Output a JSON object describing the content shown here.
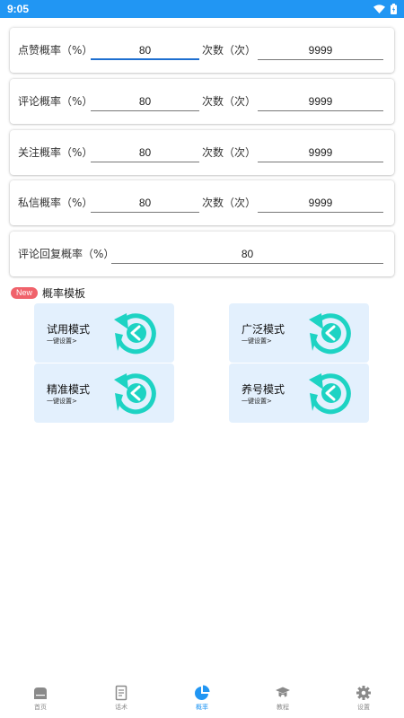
{
  "status_bar": {
    "time": "9:05"
  },
  "rate_rows": [
    {
      "label": "点赞概率（%）",
      "value": "80",
      "count_label": "次数（次）",
      "count_value": "9999"
    },
    {
      "label": "评论概率（%）",
      "value": "80",
      "count_label": "次数（次）",
      "count_value": "9999"
    },
    {
      "label": "关注概率（%）",
      "value": "80",
      "count_label": "次数（次）",
      "count_value": "9999"
    },
    {
      "label": "私信概率（%）",
      "value": "80",
      "count_label": "次数（次）",
      "count_value": "9999"
    }
  ],
  "reply_row": {
    "label": "评论回复概率（%）",
    "value": "80"
  },
  "templates_section": {
    "badge": "New",
    "title": "概率模板",
    "items": [
      {
        "name": "试用模式",
        "sub": "一键设置>"
      },
      {
        "name": "广泛模式",
        "sub": "一键设置>"
      },
      {
        "name": "精准模式",
        "sub": "一键设置>"
      },
      {
        "name": "养号模式",
        "sub": "一键设置>"
      }
    ]
  },
  "bottom_nav": [
    {
      "label": "首页",
      "icon": "home-icon"
    },
    {
      "label": "话术",
      "icon": "document-icon"
    },
    {
      "label": "概率",
      "icon": "pie-chart-icon",
      "active": true
    },
    {
      "label": "教程",
      "icon": "graduation-cap-icon"
    },
    {
      "label": "设置",
      "icon": "gear-icon"
    }
  ],
  "colors": {
    "accent": "#2196f3",
    "badge": "#f0626b",
    "template_bg": "#e3f0fd",
    "template_icon": "#1dd3c3",
    "nav_inactive": "#8a8a8a"
  }
}
